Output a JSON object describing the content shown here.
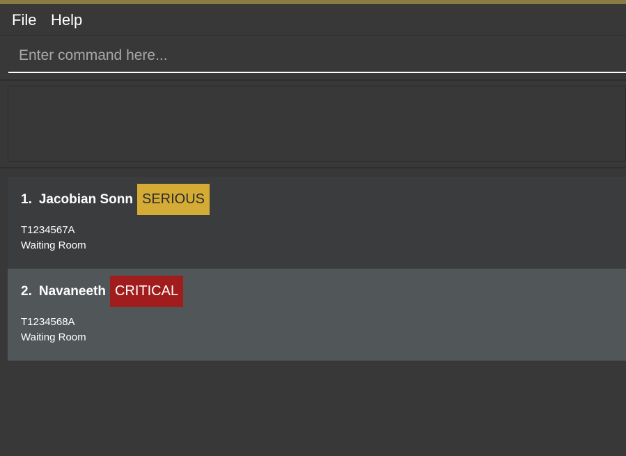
{
  "menu": {
    "file": "File",
    "help": "Help"
  },
  "command": {
    "value": "",
    "placeholder": "Enter command here..."
  },
  "result": {
    "text": ""
  },
  "patients": [
    {
      "index": "1.",
      "name": "Jacobian Sonn",
      "tag": "SERIOUS",
      "id": "T1234567A",
      "room": "Waiting Room"
    },
    {
      "index": "2.",
      "name": "Navaneeth",
      "tag": "CRITICAL",
      "id": "T1234568A",
      "room": "Waiting Room"
    }
  ],
  "colors": {
    "title_strip": "#8a7a43",
    "background": "#383838",
    "serious": "#d4ab35",
    "critical": "#a11d1d"
  }
}
